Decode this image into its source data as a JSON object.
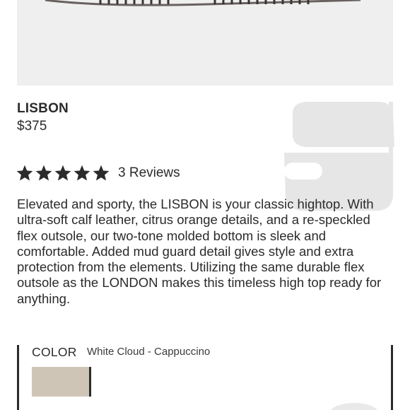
{
  "product": {
    "name": "LISBON",
    "price": "$375",
    "image_icon": "shoe-sole-icon"
  },
  "rating": {
    "stars": 5,
    "max_stars": 5,
    "reviews_label": "3 Reviews",
    "star_color": "#2b2b2b"
  },
  "description": "Elevated and sporty, the LISBON is your classic hightop. With ultra-soft calf leather, citrus orange details, and a re-speckled flex outsole, our two-tone molded bottom is sleek and comfortable.  Added mud guard detail gives style and extra protection from the elements.  Utilizing the same durable flex outsole as the LONDON makes this timeless high top ready for anything.",
  "color": {
    "label": "COLOR",
    "selected": "White Cloud - Cappuccino",
    "swatch_color": "#cfc5b7"
  },
  "watermark": {
    "icon": "brand-logo-icon",
    "color": "#e6e6e6"
  }
}
